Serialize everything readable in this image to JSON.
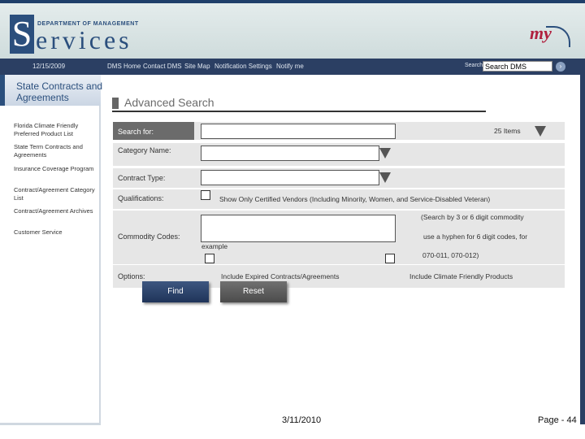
{
  "header": {
    "logo_dept_text": "DEPARTMENT OF MANAGEMENT",
    "logo_services_text": "ervices",
    "logo_s": "S",
    "myflorida": "my"
  },
  "nav": {
    "date": "12/15/2009",
    "links": [
      "DMS Home",
      "Contact DMS",
      "Site Map",
      "Notification Settings",
      "Notify me"
    ],
    "search_label": "Search",
    "search_value": "Search DMS",
    "go": "›"
  },
  "sidebar": {
    "title": "State Contracts and Agreements",
    "items": [
      "Florida Climate Friendly Preferred Product List",
      "State Term Contracts and Agreements",
      "Insurance Coverage Program",
      "Contract/Agreement Category List",
      "Contract/Agreement Archives",
      "Customer Service"
    ]
  },
  "main": {
    "page_title": "Advanced Search",
    "search_for_label": "Search for:",
    "items_count": "25 Items",
    "category_label": "Category Name:",
    "contract_type_label": "Contract Type:",
    "qualifications_label": "Qualifications:",
    "qualifications_text": "Show Only Certified Vendors (Including Minority, Women, and Service-Disabled Veteran)",
    "commodity_label": "Commodity Codes:",
    "commodity_hint_1": "(Search by 3 or 6 digit commodity",
    "commodity_hint_2": "use a hyphen for 6 digit codes, for",
    "commodity_hint_3": "example",
    "commodity_hint_4": "070-011, 070-012)",
    "options_label": "Options:",
    "option_expired": "Include Expired Contracts/Agreements",
    "option_climate": "Include Climate Friendly Products",
    "find_label": "Find",
    "reset_label": "Reset"
  },
  "footer": {
    "date": "3/11/2010",
    "page": "Page - 44"
  }
}
